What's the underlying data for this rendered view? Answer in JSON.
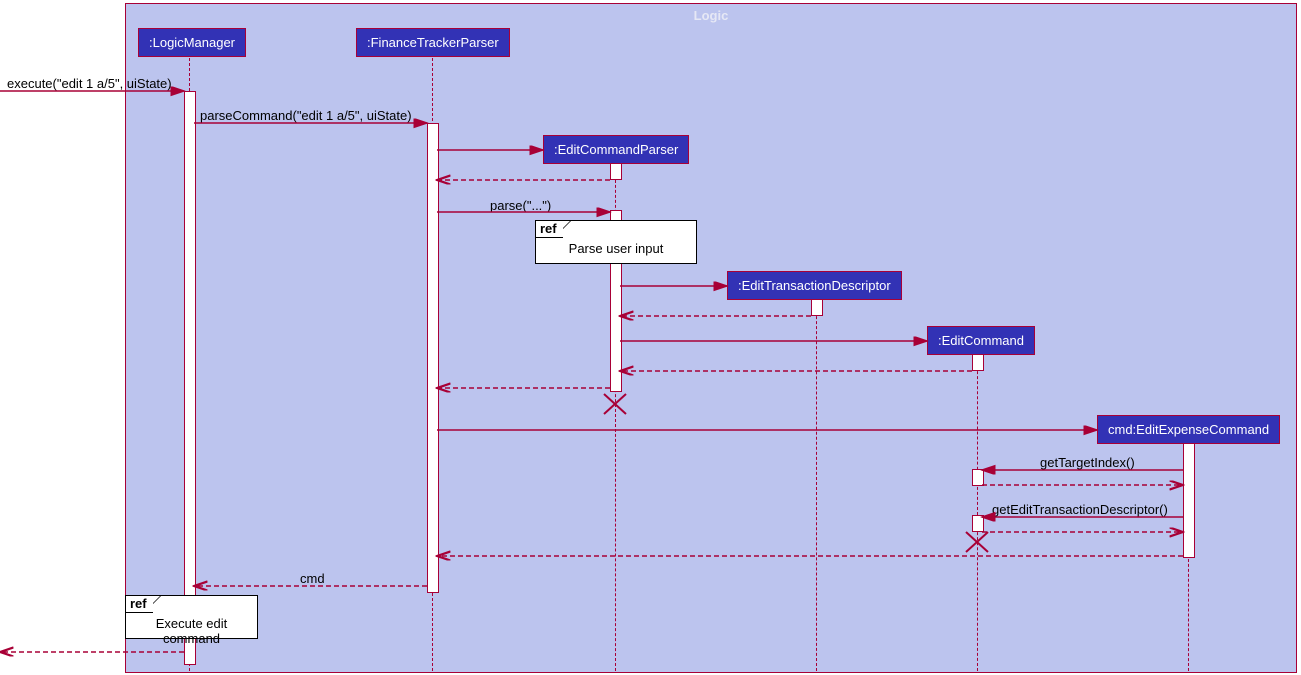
{
  "frame": {
    "title": "Logic"
  },
  "participants": {
    "logic_manager": ":LogicManager",
    "finance_tracker_parser": ":FinanceTrackerParser",
    "edit_command_parser": ":EditCommandParser",
    "edit_transaction_descriptor": ":EditTransactionDescriptor",
    "edit_command": ":EditCommand",
    "edit_expense_command": "cmd:EditExpenseCommand"
  },
  "messages": {
    "execute": "execute(\"edit 1 a/5\", uiState)",
    "parse_command": "parseCommand(\"edit 1 a/5\", uiState)",
    "parse": "parse(\"...\")",
    "get_target_index": "getTargetIndex()",
    "get_edit_tx_desc": "getEditTransactionDescriptor()",
    "return_cmd": "cmd"
  },
  "refs": {
    "parse_user_input": {
      "tag": "ref",
      "text": "Parse user input"
    },
    "execute_edit": {
      "tag": "ref",
      "text": "Execute edit command"
    }
  }
}
